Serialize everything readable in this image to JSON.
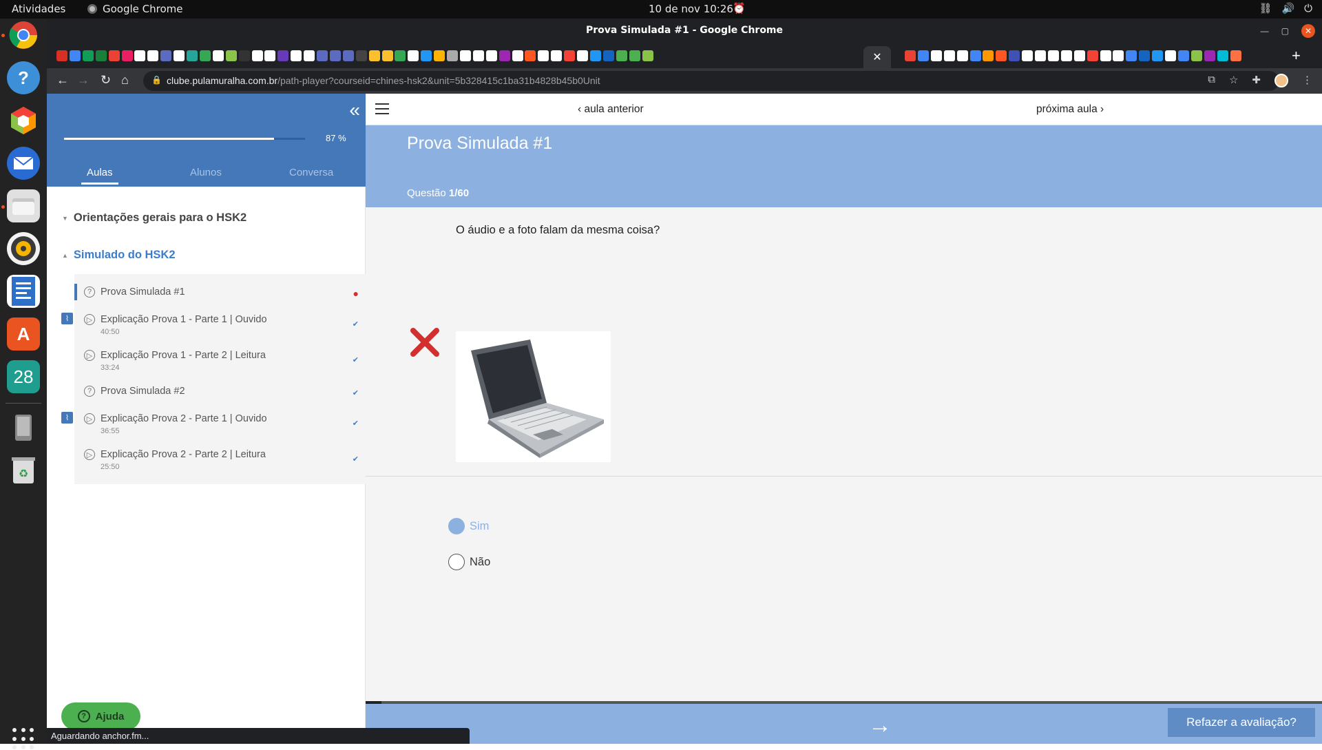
{
  "system": {
    "activities": "Atividades",
    "app_name": "Google Chrome",
    "clock": "10 de nov  10:26"
  },
  "dock": {
    "calendar_day": "28",
    "items": [
      "chrome-icon",
      "help-icon",
      "3d-cube-icon",
      "thunderbird-icon",
      "files-icon",
      "rhythmbox-icon",
      "writer-icon",
      "software-center-icon",
      "calendar-icon",
      "usb-drive-icon",
      "trash-icon",
      "app-grid-icon"
    ]
  },
  "browser": {
    "window_title": "Prova Simulada #1 - Google Chrome",
    "url_host": "clube.pulamuralha.com.br",
    "url_path": "/path-player?courseid=chines-hsk2&unit=5b328415c1ba31b4828b45b0Unit",
    "status_text": "Aguardando anchor.fm...",
    "favicon_colors": [
      "#d93025",
      "#4285f4",
      "#0f9d58",
      "#188038",
      "#ea4335",
      "#e91e63",
      "#ffffff",
      "#ffffff",
      "#5c6bc0",
      "#ffffff",
      "#26a69a",
      "#34a853",
      "#ffffff",
      "#8bc34a",
      "#333333",
      "#ffffff",
      "#ffffff",
      "#673ab7",
      "#ffffff",
      "#ffffff",
      "#5c6bc0",
      "#5c6bc0",
      "#5c6bc0",
      "#444444",
      "#fbc02d",
      "#fbc02d",
      "#34a853",
      "#ffffff",
      "#2196f3",
      "#ffb300",
      "#aaaaaa",
      "#ffffff",
      "#ffffff",
      "#ffffff",
      "#9c27b0",
      "#ffffff",
      "#ff5722",
      "#ffffff",
      "#ffffff",
      "#f44336",
      "#ffffff",
      "#2196f3",
      "#1565c0",
      "#4caf50",
      "#4caf50",
      "#8bc34a"
    ],
    "favicon_colors_right": [
      "#ea4335",
      "#4285f4",
      "#ffffff",
      "#ffffff",
      "#ffffff",
      "#4285f4",
      "#ff9800",
      "#ff5722",
      "#3f51b5",
      "#ffffff",
      "#ffffff",
      "#ffffff",
      "#ffffff",
      "#ffffff",
      "#f44336",
      "#ffffff",
      "#ffffff",
      "#4285f4",
      "#1565c0",
      "#2196f3",
      "#ffffff",
      "#4285f4",
      "#8bc34a",
      "#9c27b0",
      "#00bcd4",
      "#ff7043"
    ]
  },
  "sidebar": {
    "progress_text": "87 %",
    "progress_value": 0.87,
    "tabs": [
      "Aulas",
      "Alunos",
      "Conversa"
    ],
    "sections": [
      {
        "title": "Orientações gerais para o HSK2"
      },
      {
        "title": "Simulado do HSK2"
      }
    ],
    "lessons": [
      {
        "title": "Prova Simulada #1",
        "duration": "",
        "icon": "question-icon",
        "status": "current"
      },
      {
        "title": "Explicação Prova 1 - Parte 1 | Ouvido",
        "duration": "40:50",
        "icon": "play-icon",
        "status": "done"
      },
      {
        "title": "Explicação Prova 1 - Parte 2 | Leitura",
        "duration": "33:24",
        "icon": "play-icon",
        "status": "done"
      },
      {
        "title": "Prova Simulada #2",
        "duration": "",
        "icon": "question-icon",
        "status": "done"
      },
      {
        "title": "Explicação Prova 2 - Parte 1 | Ouvido",
        "duration": "36:55",
        "icon": "play-icon",
        "status": "done"
      },
      {
        "title": "Explicação Prova 2 - Parte 2 | Leitura",
        "duration": "25:50",
        "icon": "play-icon",
        "status": "done"
      }
    ],
    "help_label": "Ajuda"
  },
  "content": {
    "prev_label": "aula anterior",
    "next_label": "próxima aula",
    "title": "Prova Simulada #1",
    "question_label": "Questão",
    "question_counter": "1/60",
    "question_text": "O áudio e a foto falam da mesma coisa?",
    "result": "incorrect",
    "options": [
      {
        "label": "Sim",
        "selected": true
      },
      {
        "label": "Não",
        "selected": false
      }
    ],
    "retry_label": "Refazer a avaliação?",
    "accent_color": "#8cb0e0"
  }
}
